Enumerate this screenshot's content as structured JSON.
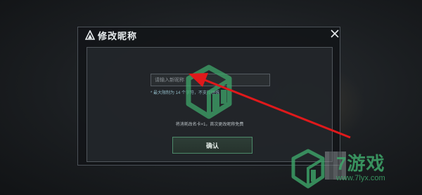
{
  "dialog": {
    "title": "修改昵称",
    "input_placeholder": "请输入新昵称",
    "limit_note": "* 最大限制为 14 个字符，不支持特殊",
    "cost_note": "将消耗改名卡×1，首次更改昵称免费",
    "confirm_label": "确认"
  },
  "watermark": {
    "brand": "7游戏",
    "url": "www.7lyx.com"
  },
  "colors": {
    "accent_green": "#3ea66a",
    "arrow_red": "#e0191b",
    "dialog_border": "#4b5158"
  },
  "icons": {
    "title": "triangle-logo-icon",
    "close": "close-icon",
    "watermark": "cube-logo-icon"
  }
}
